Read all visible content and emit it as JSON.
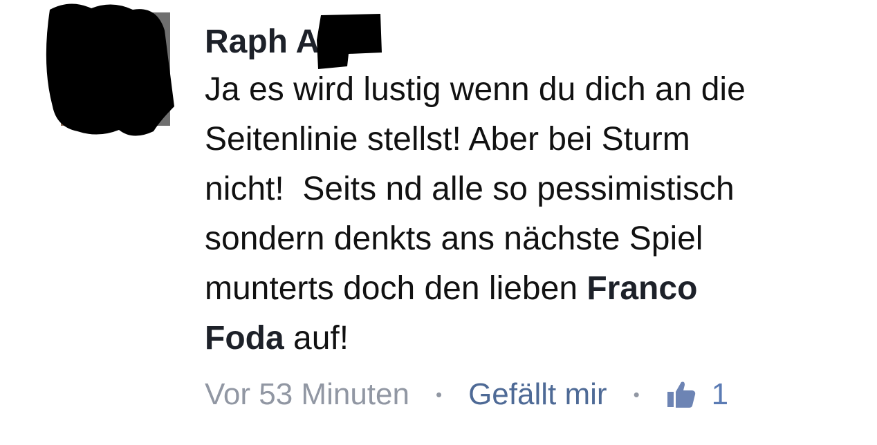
{
  "comment": {
    "author": "Raph A",
    "body_lines": [
      "Ja es wird lustig wenn du dich an die",
      "Seitenlinie stellst! Aber bei Sturm",
      "nicht!  Seits nd alle so pessimistisch",
      "sondern denkts ans nächste Spiel",
      "munterts doch den lieben ",
      " auf!"
    ],
    "mention": [
      "Franco",
      "Foda"
    ],
    "timestamp": "Vor 53 Minuten",
    "separator": "•",
    "like_label": "Gefällt mir",
    "like_count": "1"
  },
  "colors": {
    "author": "#1d2129",
    "body": "#111111",
    "meta_gray": "#9197a3",
    "link_blue": "#4e6a96",
    "thumb_blue": "#6d84b4",
    "redaction": "#000000"
  },
  "icons": {
    "like": "thumbs-up-icon"
  }
}
